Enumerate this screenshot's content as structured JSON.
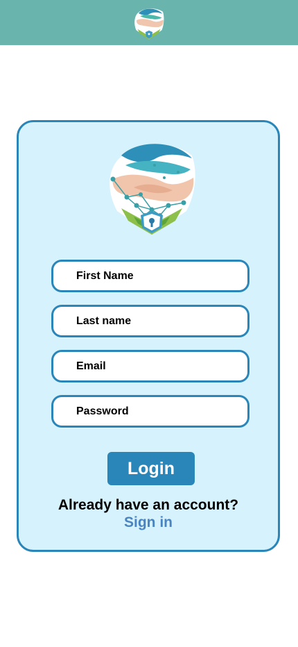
{
  "header": {
    "logo_icon": "hands-network-shield-logo",
    "background_color": "#69b5ad"
  },
  "form": {
    "logo_icon": "hands-network-shield-logo",
    "fields": {
      "first_name": {
        "placeholder": "First Name",
        "value": ""
      },
      "last_name": {
        "placeholder": "Last name",
        "value": ""
      },
      "email": {
        "placeholder": "Email",
        "value": ""
      },
      "password": {
        "placeholder": "Password",
        "value": ""
      }
    },
    "login_label": "Login",
    "account_prompt": "Already have an account?",
    "signin_label": "Sign in"
  },
  "colors": {
    "accent": "#2a86b8",
    "card_background": "#d6f2fd",
    "link": "#4a84c0"
  }
}
